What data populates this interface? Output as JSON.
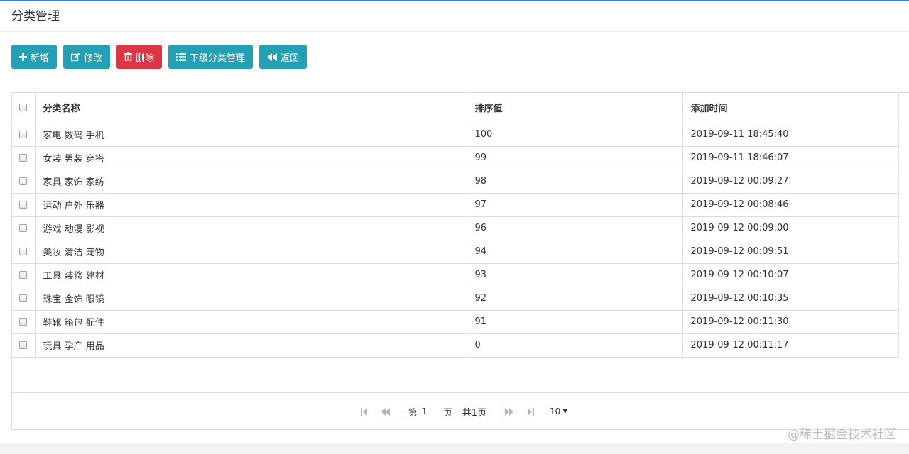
{
  "panel": {
    "title": "分类管理"
  },
  "toolbar": {
    "add_label": "新增",
    "edit_label": "修改",
    "delete_label": "删除",
    "sub_label": "下级分类管理",
    "back_label": "返回"
  },
  "table": {
    "headers": {
      "name": "分类名称",
      "sort": "排序值",
      "time": "添加时间"
    },
    "rows": [
      {
        "name": "家电 数码 手机",
        "sort": "100",
        "time": "2019-09-11 18:45:40"
      },
      {
        "name": "女装 男装 穿搭",
        "sort": "99",
        "time": "2019-09-11 18:46:07"
      },
      {
        "name": "家具 家饰 家纺",
        "sort": "98",
        "time": "2019-09-12 00:09:27"
      },
      {
        "name": "运动 户外 乐器",
        "sort": "97",
        "time": "2019-09-12 00:08:46"
      },
      {
        "name": "游戏 动漫 影视",
        "sort": "96",
        "time": "2019-09-12 00:09:00"
      },
      {
        "name": "美妆 清洁 宠物",
        "sort": "94",
        "time": "2019-09-12 00:09:51"
      },
      {
        "name": "工具 装修 建材",
        "sort": "93",
        "time": "2019-09-12 00:10:07"
      },
      {
        "name": "珠宝 金饰 眼镜",
        "sort": "92",
        "time": "2019-09-12 00:10:35"
      },
      {
        "name": "鞋靴 箱包 配件",
        "sort": "91",
        "time": "2019-09-12 00:11:30"
      },
      {
        "name": "玩具 孕产 用品",
        "sort": "0",
        "time": "2019-09-12 00:11:17"
      }
    ]
  },
  "pager": {
    "page_prefix": "第",
    "page_value": "1",
    "page_suffix": "页",
    "total_text": "共1页",
    "page_size": "10"
  },
  "watermark": "@稀土掘金技术社区",
  "colors": {
    "info": "#23a0b3",
    "danger": "#dc3545",
    "accent_line": "#1e88e5"
  }
}
